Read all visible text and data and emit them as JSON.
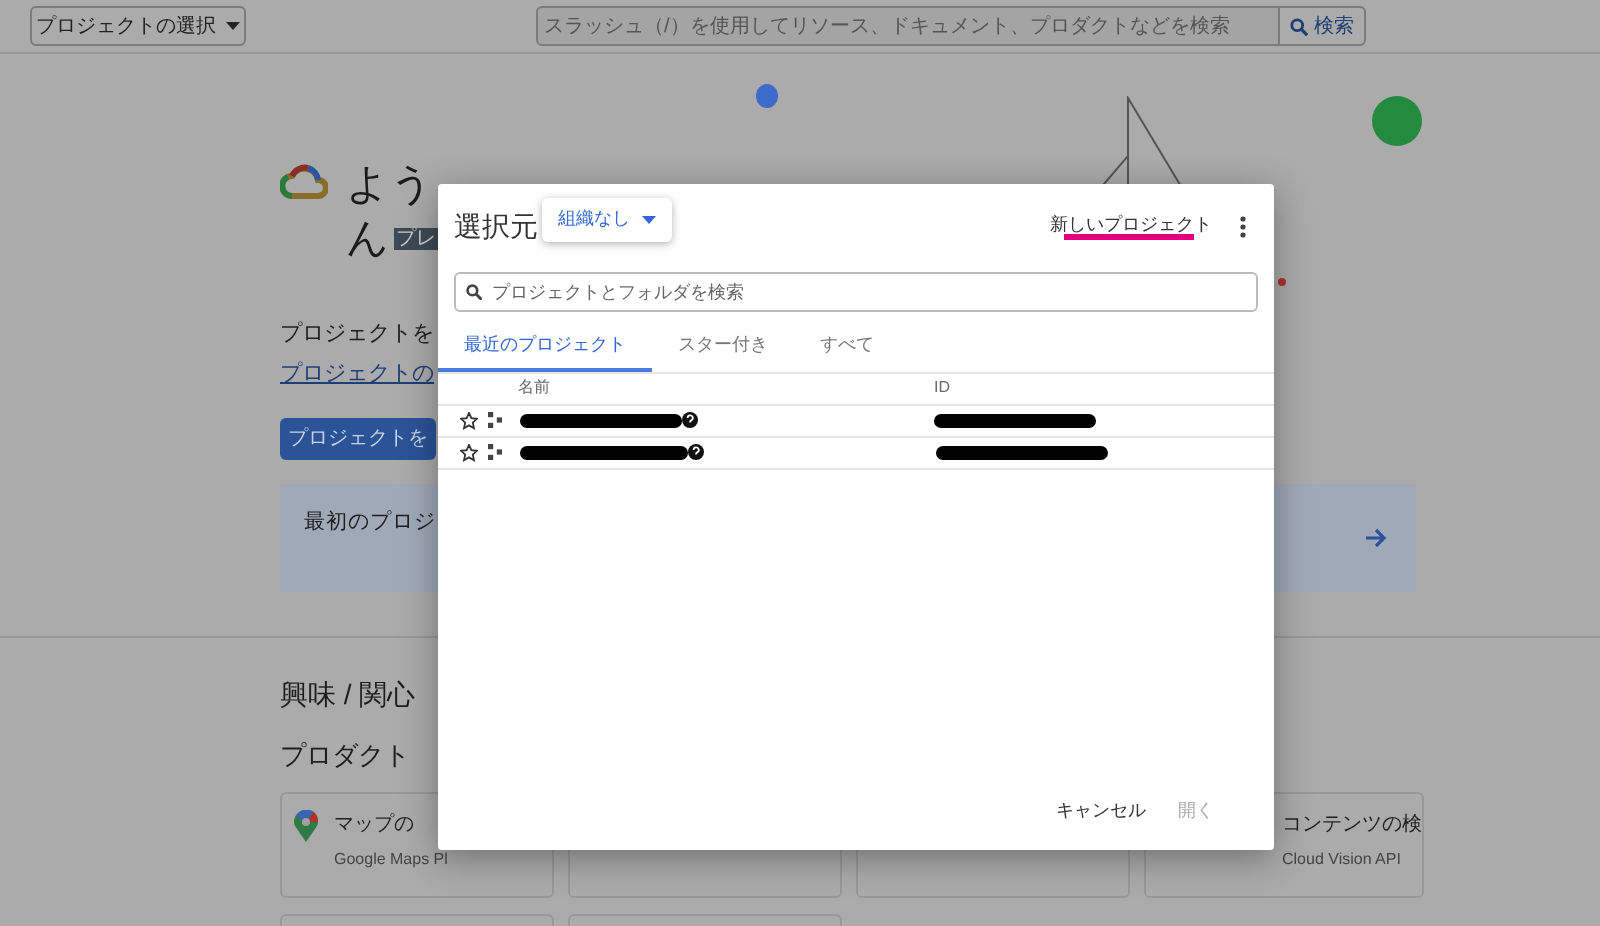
{
  "top_bar": {
    "project_picker": "プロジェクトの選択",
    "search": {
      "placeholder": "スラッシュ（/）を使用してリソース、ドキュメント、プロダクトなどを検索"
    },
    "search_button": "検索"
  },
  "welcome": {
    "heading": "よう",
    "heading_line2": "ん",
    "badge": "プレ"
  },
  "intro": {
    "text": "プロジェクトを",
    "link": "プロジェクトの",
    "button": "プロジェクトを"
  },
  "first_project_card": {
    "text": "最初のプロジ"
  },
  "interests_heading": "興味 / 関心",
  "products_heading": "プロダクト",
  "product_cards": [
    {
      "title": "マップの",
      "subtitle": "Google Maps Pl",
      "kind": "maps"
    },
    {
      "kind": "blank"
    },
    {
      "kind": "blank"
    },
    {
      "title": "コンテンツの検",
      "subtitle": "Cloud Vision API",
      "kind": "plain"
    }
  ],
  "dialog": {
    "source_label": "選択元",
    "organization": "組織なし",
    "new_project": "新しいプロジェクト",
    "search": {
      "placeholder": "プロジェクトとフォルダを検索"
    },
    "tabs": [
      {
        "label": "最近のプロジェクト",
        "selected": true
      },
      {
        "label": "スター付き",
        "selected": false
      },
      {
        "label": "すべて",
        "selected": false
      }
    ],
    "columns": [
      "名前",
      "ID"
    ],
    "rows": [
      {
        "starred": false
      },
      {
        "starred": false
      }
    ],
    "buttons": [
      {
        "label": "キャンセル",
        "disabled": false
      },
      {
        "label": "開く",
        "disabled": true
      }
    ]
  }
}
